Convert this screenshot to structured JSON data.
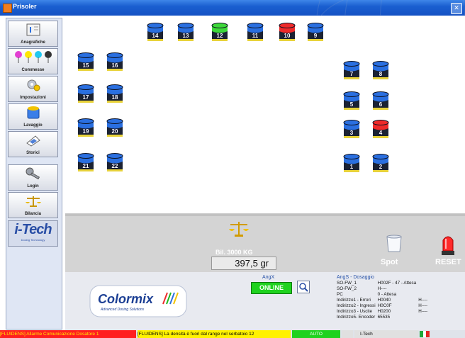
{
  "window": {
    "title": "Prisoler"
  },
  "sidebar": {
    "items": [
      {
        "label": "Anagrafiche",
        "icon": "folder-documents-icon"
      },
      {
        "label": "Commesse",
        "icon": "color-pins-icon"
      },
      {
        "label": "Impostazioni",
        "icon": "settings-icon"
      },
      {
        "label": "Lavaggio",
        "icon": "wash-can-icon"
      },
      {
        "label": "Storici",
        "icon": "history-icon"
      },
      {
        "label": "Login",
        "icon": "key-icon"
      },
      {
        "label": "Bilancia",
        "icon": "scale-icon"
      }
    ],
    "brand": {
      "name": "i-Tech",
      "tagline": "Dosing Technology"
    }
  },
  "drums": [
    {
      "id": "14",
      "color": "blue"
    },
    {
      "id": "13",
      "color": "blue"
    },
    {
      "id": "12",
      "color": "green"
    },
    {
      "id": "11",
      "color": "blue"
    },
    {
      "id": "10",
      "color": "red"
    },
    {
      "id": "9",
      "color": "blue"
    },
    {
      "id": "15",
      "color": "blue"
    },
    {
      "id": "16",
      "color": "blue"
    },
    {
      "id": "17",
      "color": "blue"
    },
    {
      "id": "18",
      "color": "blue"
    },
    {
      "id": "19",
      "color": "blue"
    },
    {
      "id": "20",
      "color": "blue"
    },
    {
      "id": "21",
      "color": "blue"
    },
    {
      "id": "22",
      "color": "blue"
    },
    {
      "id": "7",
      "color": "blue"
    },
    {
      "id": "8",
      "color": "blue"
    },
    {
      "id": "5",
      "color": "blue"
    },
    {
      "id": "6",
      "color": "blue"
    },
    {
      "id": "3",
      "color": "blue"
    },
    {
      "id": "4",
      "color": "red"
    },
    {
      "id": "1",
      "color": "blue"
    },
    {
      "id": "2",
      "color": "blue"
    }
  ],
  "colors": {
    "blue": "#2a6fe0",
    "green": "#3ed83a",
    "red": "#ee2a2a"
  },
  "scale": {
    "label": "Bil. 3000 KG",
    "value": "397,5 gr"
  },
  "actions": {
    "spot_label": "Spot",
    "reset_label": "RESET"
  },
  "brand_logo": {
    "name": "Colormix",
    "tagline": "Advanced Dosing Solutions"
  },
  "angx": {
    "title": "AngX",
    "status": "ONLINE"
  },
  "angs": {
    "title": "AngS - Dosaggio",
    "rows": [
      [
        "SO-FW_1",
        "H002F - 47 - Attesa",
        ""
      ],
      [
        "SO-FW_2",
        "H----",
        ""
      ],
      [
        "PC",
        "0 - Attesa",
        ""
      ],
      [
        "Indirizzo1 - Errori",
        "H0040",
        "H----"
      ],
      [
        "Indirizzo2 - Ingressi",
        "H0C0F",
        "H----"
      ],
      [
        "Indirizzo3 - Uscite",
        "H0200",
        "H----"
      ],
      [
        "Indirizzo5- Encoder",
        "65535",
        ""
      ]
    ]
  },
  "statusbar": {
    "error": "[FLUIDENS] Allarme Comunicazione Dosatore 1",
    "warning": "[FLUIDENS] La densità è fuori dal range nel serbatoio 12",
    "mode": "AUTO",
    "company": "I-Tech"
  }
}
